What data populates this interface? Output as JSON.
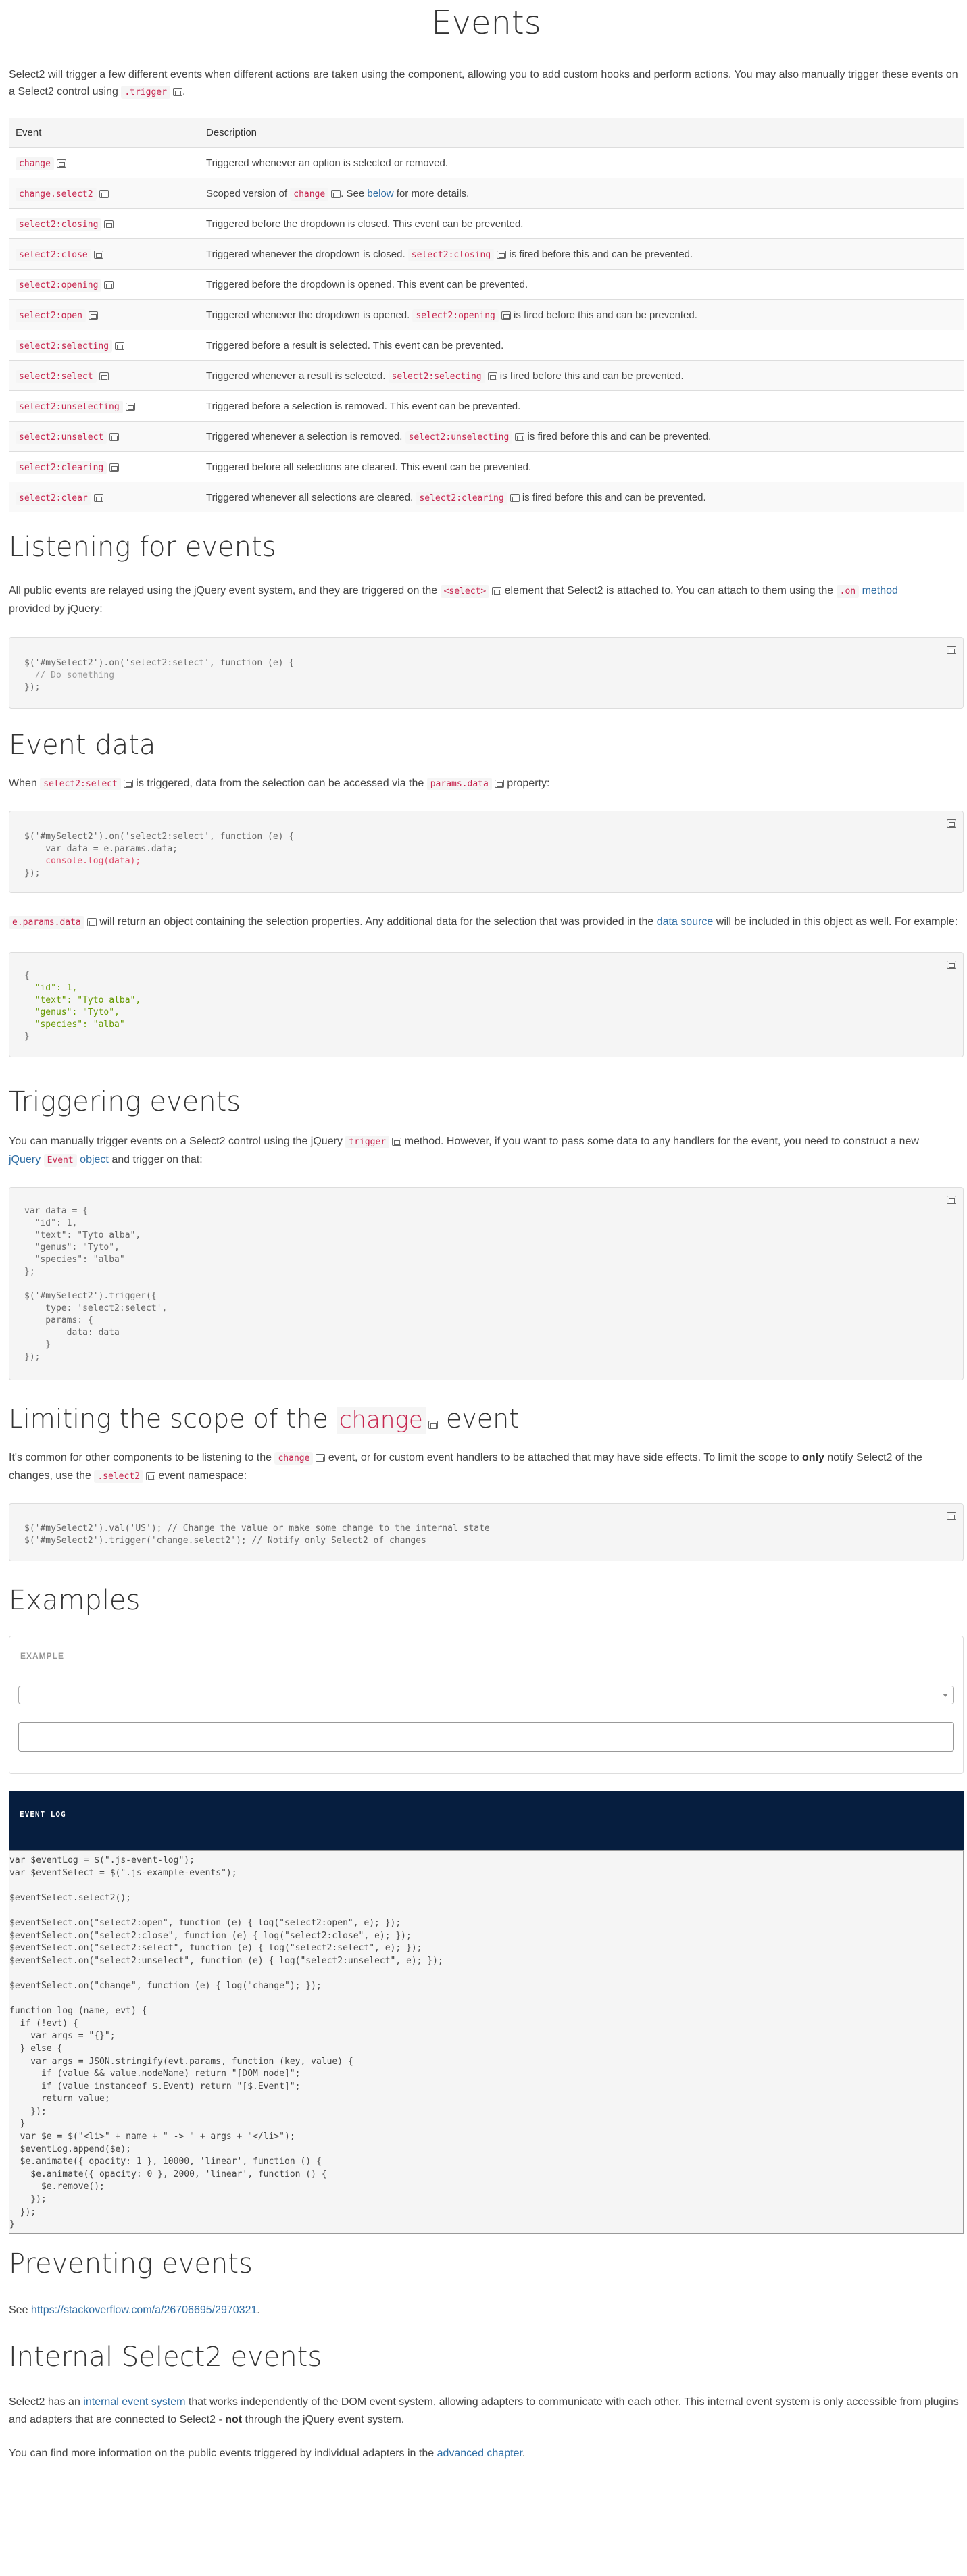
{
  "title": "Events",
  "intro": {
    "text1": "Select2 will trigger a few different events when different actions are taken using the component, allowing you to add custom hooks and perform actions. You may also manually trigger these events on a Select2 control using ",
    "code": ".trigger",
    "text2": "."
  },
  "events_table": {
    "headers": [
      "Event",
      "Description"
    ],
    "rows": [
      {
        "event": "change",
        "pre": "Triggered whenever an option is selected or removed.",
        "code": "",
        "post": ""
      },
      {
        "event": "change.select2",
        "pre": "Scoped version of ",
        "code": "change",
        "post": ". See ",
        "link": "below",
        "post2": " for more details."
      },
      {
        "event": "select2:closing",
        "pre": "Triggered before the dropdown is closed. This event can be prevented.",
        "code": "",
        "post": ""
      },
      {
        "event": "select2:close",
        "pre": "Triggered whenever the dropdown is closed. ",
        "code": "select2:closing",
        "post": " is fired before this and can be prevented."
      },
      {
        "event": "select2:opening",
        "pre": "Triggered before the dropdown is opened. This event can be prevented.",
        "code": "",
        "post": ""
      },
      {
        "event": "select2:open",
        "pre": "Triggered whenever the dropdown is opened. ",
        "code": "select2:opening",
        "post": " is fired before this and can be prevented."
      },
      {
        "event": "select2:selecting",
        "pre": "Triggered before a result is selected. This event can be prevented.",
        "code": "",
        "post": ""
      },
      {
        "event": "select2:select",
        "pre": "Triggered whenever a result is selected. ",
        "code": "select2:selecting",
        "post": " is fired before this and can be prevented."
      },
      {
        "event": "select2:unselecting",
        "pre": "Triggered before a selection is removed. This event can be prevented.",
        "code": "",
        "post": ""
      },
      {
        "event": "select2:unselect",
        "pre": "Triggered whenever a selection is removed. ",
        "code": "select2:unselecting",
        "post": " is fired before this and can be prevented."
      },
      {
        "event": "select2:clearing",
        "pre": "Triggered before all selections are cleared. This event can be prevented.",
        "code": "",
        "post": ""
      },
      {
        "event": "select2:clear",
        "pre": "Triggered whenever all selections are cleared. ",
        "code": "select2:clearing",
        "post": " is fired before this and can be prevented."
      }
    ]
  },
  "listening": {
    "heading": "Listening for events",
    "t1": "All public events are relayed using the jQuery event system, and they are triggered on the ",
    "code1": "<select>",
    "t2": " element that Select2 is attached to. You can attach to them using the ",
    "code2": ".on",
    "link": "method",
    "t3": "provided by jQuery:"
  },
  "event_data": {
    "heading": "Event data",
    "t1": "When ",
    "code1": "select2:select",
    "t2": " is triggered, data from the selection can be accessed via the ",
    "code2": "params.data",
    "t3": " property:",
    "p2_code": "e.params.data",
    "p2_t1": " will return an object containing the selection properties. Any additional data for the selection that was provided in the ",
    "p2_link": "data source",
    "p2_t2": " will be included in this object as well. For example:"
  },
  "triggering": {
    "heading": "Triggering events",
    "t1": "You can manually trigger events on a Select2 control using the jQuery ",
    "code1": "trigger",
    "t2": " method. However, if you want to pass some data to any handlers for the event, you need to construct a new ",
    "link1": "jQuery",
    "code2": "Event",
    "link2": "object",
    "t3": " and trigger on that:"
  },
  "limiting": {
    "heading_pre": "Limiting the scope of the ",
    "heading_code": "change",
    "heading_post": " event",
    "t1": "It's common for other components to be listening to the ",
    "code1": "change",
    "t2": " event, or for custom event handlers to be attached that may have side effects. To limit the scope to ",
    "bold": "only",
    "t3": " notify Select2 of the changes, use the ",
    "code2": ".select2",
    "t4": " event namespace:"
  },
  "examples": {
    "heading": "Examples",
    "example_label": "EXAMPLE",
    "event_log_label": "EVENT LOG"
  },
  "preventing": {
    "heading": "Preventing events",
    "t1": "See ",
    "link": "https://stackoverflow.com/a/26706695/2970321",
    "t2": "."
  },
  "internal": {
    "heading": "Internal Select2 events",
    "t1": "Select2 has an ",
    "link1": "internal event system",
    "t2": " that works independently of the DOM event system, allowing adapters to communicate with each other. This internal event system is only accessible from plugins and adapters that are connected to Select2 - ",
    "bold": "not",
    "t3": " through the jQuery event system.",
    "p2_t1": "You can find more information on the public events triggered by individual adapters in the ",
    "p2_link": "advanced chapter",
    "p2_t2": "."
  },
  "code_samples": {
    "listening": [
      "$('#mySelect2').on('select2:select', function (e) {",
      "  // Do something",
      "});"
    ],
    "event_data": [
      "$('#mySelect2').on('select2:select', function (e) {",
      "    var data = e.params.data;",
      "    console.log(data);",
      "});"
    ],
    "object": [
      "{",
      "  \"id\": 1,",
      "  \"text\": \"Tyto alba\",",
      "  \"genus\": \"Tyto\",",
      "  \"species\": \"alba\"",
      "}"
    ],
    "trigger": [
      "var data = {",
      "  \"id\": 1,",
      "  \"text\": \"Tyto alba\",",
      "  \"genus\": \"Tyto\",",
      "  \"species\": \"alba\"",
      "};",
      "",
      "$('#mySelect2').trigger({",
      "    type: 'select2:select',",
      "    params: {",
      "        data: data",
      "    }",
      "});"
    ],
    "limit": [
      "$('#mySelect2').val('US'); // Change the value or make some change to the internal state",
      "$('#mySelect2').trigger('change.select2'); // Notify only Select2 of changes"
    ],
    "log": [
      "var $eventLog = $(\".js-event-log\");",
      "var $eventSelect = $(\".js-example-events\");",
      "",
      "$eventSelect.select2();",
      "",
      "$eventSelect.on(\"select2:open\", function (e) { log(\"select2:open\", e); });",
      "$eventSelect.on(\"select2:close\", function (e) { log(\"select2:close\", e); });",
      "$eventSelect.on(\"select2:select\", function (e) { log(\"select2:select\", e); });",
      "$eventSelect.on(\"select2:unselect\", function (e) { log(\"select2:unselect\", e); });",
      "",
      "$eventSelect.on(\"change\", function (e) { log(\"change\"); });",
      "",
      "function log (name, evt) {",
      "  if (!evt) {",
      "    var args = \"{}\";",
      "  } else {",
      "    var args = JSON.stringify(evt.params, function (key, value) {",
      "      if (value && value.nodeName) return \"[DOM node]\";",
      "      if (value instanceof $.Event) return \"[$.Event]\";",
      "      return value;",
      "    });",
      "  }",
      "  var $e = $(\"<li>\" + name + \" -> \" + args + \"</li>\");",
      "  $eventLog.append($e);",
      "  $e.animate({ opacity: 1 }, 10000, 'linear', function () {",
      "    $e.animate({ opacity: 0 }, 2000, 'linear', function () {",
      "      $e.remove();",
      "    });",
      "  });",
      "}"
    ]
  }
}
